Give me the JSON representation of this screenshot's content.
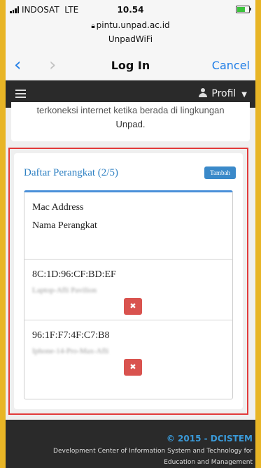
{
  "status_bar": {
    "carrier": "INDOSAT",
    "network": "LTE",
    "time": "10.54",
    "host": "pintu.unpad.ac.id",
    "ssid": "UnpadWiFi"
  },
  "nav": {
    "back_icon": "chevron-left",
    "forward_icon": "chevron-right",
    "title": "Log In",
    "cancel_label": "Cancel"
  },
  "app_bar": {
    "menu_icon": "hamburger",
    "profile_label": "Profil"
  },
  "previous_card": {
    "line1": "terkoneksi internet ketika berada di lingkungan",
    "line2": "Unpad."
  },
  "devices_panel": {
    "title": "Daftar Perangkat (2/5)",
    "add_button": "Tambah",
    "header": {
      "mac_label": "Mac Address",
      "name_label": "Nama Perangkat"
    },
    "devices": [
      {
        "mac": "8C:1D:96:CF:BD:EF",
        "name": "Laptop-Afli Pavilion"
      },
      {
        "mac": "96:1F:F7:4F:C7:B8",
        "name": "Iphone-14-Pro-Max-Afli"
      }
    ],
    "delete_icon": "close-x"
  },
  "footer": {
    "copyright": "© 2015 - DCISTEM",
    "line1": "Development Center of Information System and Technology for",
    "line2": "Education and Management"
  },
  "colors": {
    "frame": "#e8b526",
    "accent_blue": "#1f7de6",
    "panel_highlight": "#e23a3a",
    "delete": "#d9534f",
    "dark_bar": "#2a2a2a"
  }
}
